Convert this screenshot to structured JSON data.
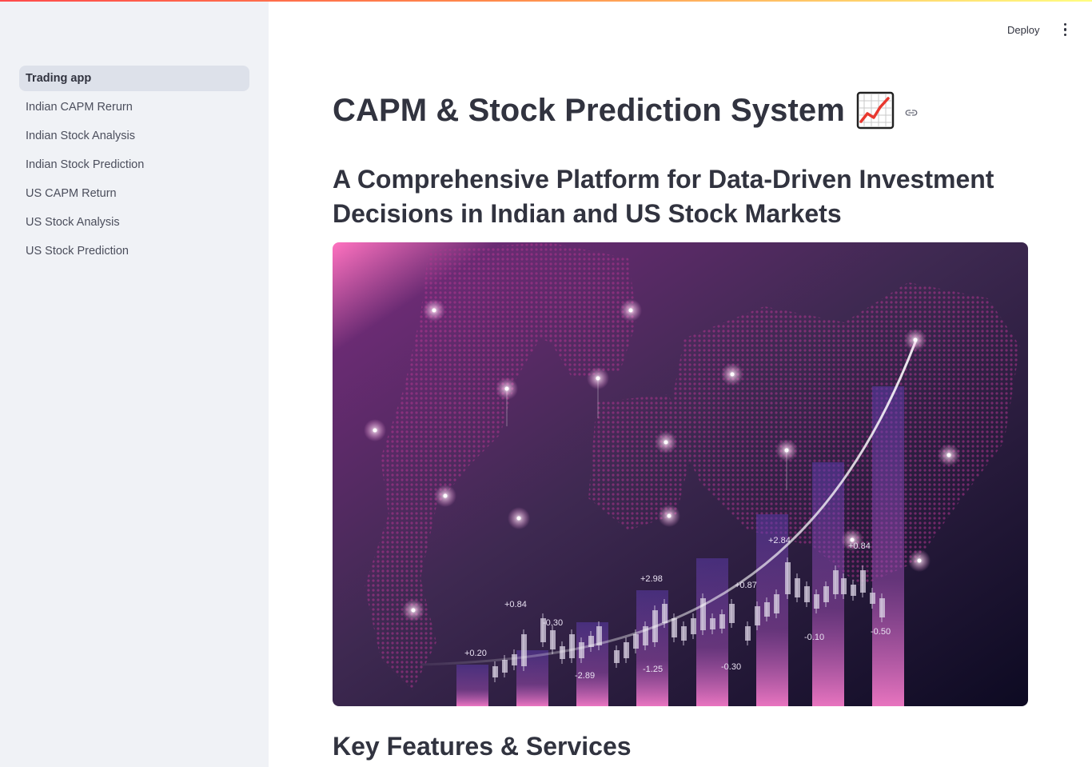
{
  "sidebar": {
    "items": [
      {
        "label": "Trading app",
        "active": true
      },
      {
        "label": "Indian CAPM Rerurn",
        "active": false
      },
      {
        "label": "Indian Stock Analysis",
        "active": false
      },
      {
        "label": "Indian Stock Prediction",
        "active": false
      },
      {
        "label": "US CAPM Return",
        "active": false
      },
      {
        "label": "US Stock Analysis",
        "active": false
      },
      {
        "label": "US Stock Prediction",
        "active": false
      }
    ]
  },
  "header": {
    "deploy_label": "Deploy",
    "menu_icon": "vertical-dots-icon"
  },
  "main": {
    "title": "CAPM & Stock Prediction System",
    "title_icon": "chart-increasing-icon",
    "anchor_icon": "link-icon",
    "subtitle": "A Comprehensive Platform for Data-Driven Investment Decisions in Indian and US Stock Markets",
    "hero_image": {
      "labels": [
        "+0.20",
        "+0.84",
        "-0.30",
        "-2.89",
        "+2.98",
        "-1.25",
        "-0.30",
        "+0.87",
        "+2.84",
        "-0.10",
        "+0.84",
        "-0.50"
      ]
    },
    "section_heading": "Key Features & Services"
  },
  "colors": {
    "sidebar_bg": "#f0f2f6",
    "active_item_bg": "#dde1ea",
    "text": "#31333f",
    "hero_bg_dark": "#1f1430",
    "hero_accent": "#ff7ac6"
  }
}
